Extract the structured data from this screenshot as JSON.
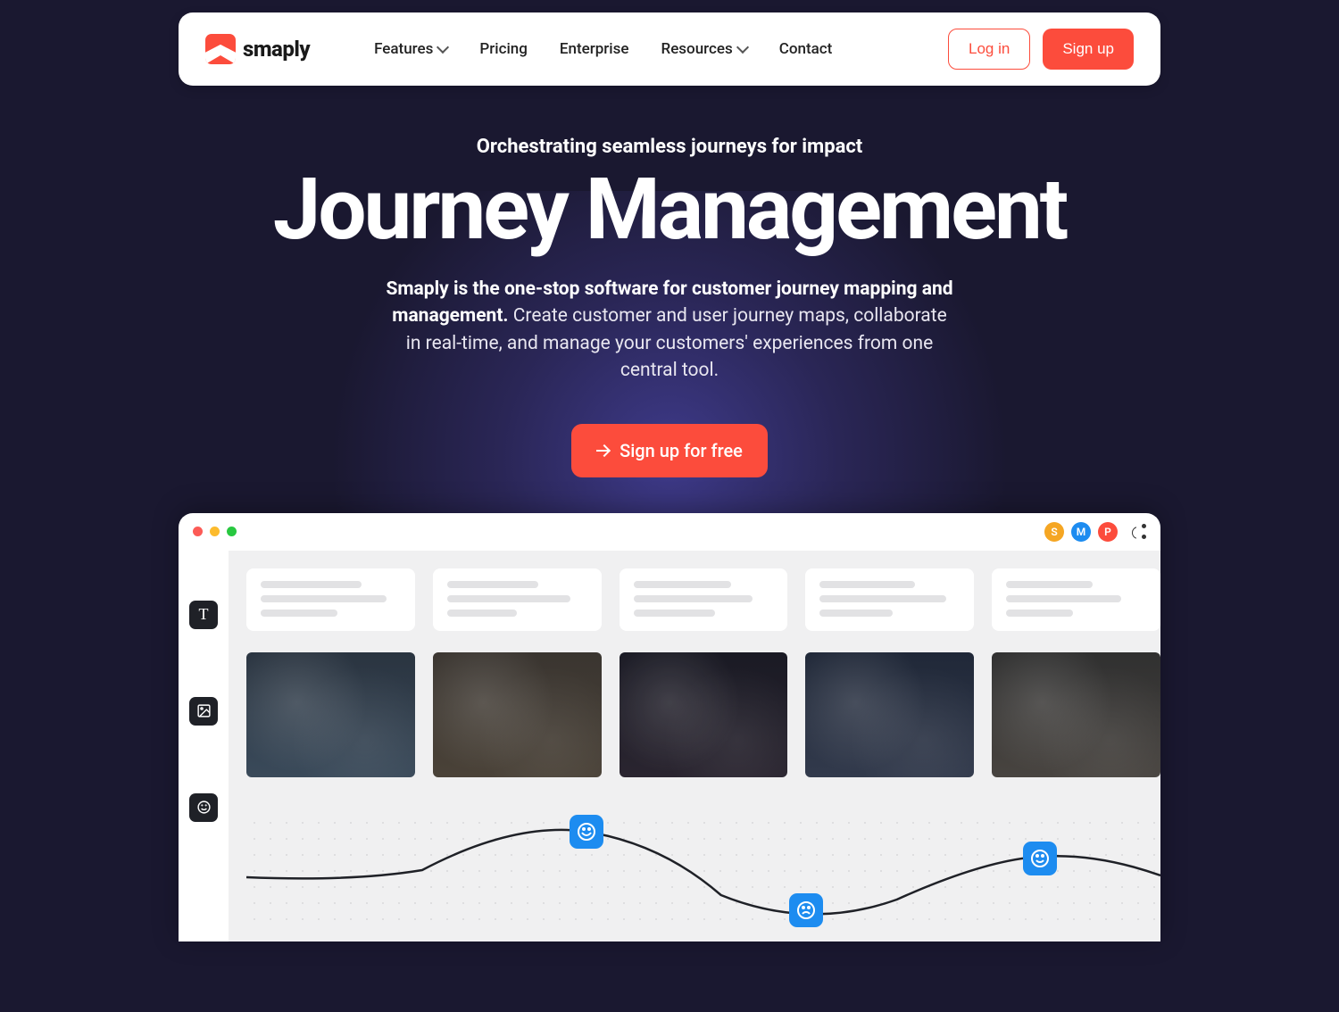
{
  "brand": "smaply",
  "nav": {
    "features": "Features",
    "pricing": "Pricing",
    "enterprise": "Enterprise",
    "resources": "Resources",
    "contact": "Contact",
    "login": "Log in",
    "signup": "Sign up"
  },
  "hero": {
    "tagline": "Orchestrating seamless journeys for impact",
    "headline": "Journey Management",
    "sub_bold": "Smaply is the one-stop software for customer journey mapping and management.",
    "sub_rest": " Create customer and user journey maps, collaborate in real-time, and manage your customers' experiences from one central tool.",
    "cta": "Sign up for free"
  },
  "window": {
    "traffic": {
      "red": "#fc5b56",
      "yellow": "#fcbb2d",
      "green": "#28c840"
    },
    "avatars": [
      {
        "letter": "S",
        "bg": "#f5a623"
      },
      {
        "letter": "M",
        "bg": "#1d8cf0"
      },
      {
        "letter": "P",
        "bg": "#fc4c3c"
      }
    ],
    "rail": {
      "text": "T",
      "image": "image-icon",
      "emotion": "emotion-icon"
    }
  },
  "colors": {
    "accent": "#fc4c3c",
    "emotion": "#1d8cf0"
  }
}
